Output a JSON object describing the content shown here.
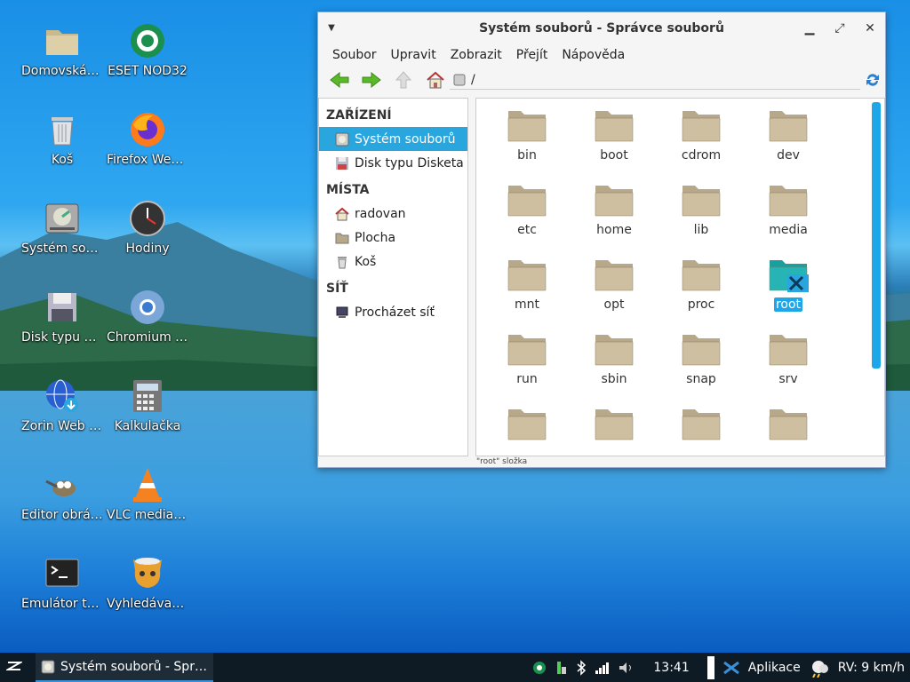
{
  "desktop": {
    "icons": [
      {
        "label": "Domovská složka",
        "icon": "home-folder-icon"
      },
      {
        "label": "ESET NOD32",
        "icon": "eset-icon"
      },
      {
        "label": "Koš",
        "icon": "trash-icon"
      },
      {
        "label": "Firefox Web Browser",
        "icon": "firefox-icon"
      },
      {
        "label": "Systém souborů",
        "icon": "filesystem-icon"
      },
      {
        "label": "Hodiny",
        "icon": "clock-icon"
      },
      {
        "label": "Disk typu Disketa",
        "icon": "floppy-icon"
      },
      {
        "label": "Chromium Web Browser",
        "icon": "chromium-icon"
      },
      {
        "label": "Zorin Web Browser",
        "icon": "web-install-icon"
      },
      {
        "label": "Kalkulačka",
        "icon": "calculator-icon"
      },
      {
        "label": "Editor obrázků",
        "icon": "gimp-icon"
      },
      {
        "label": "VLC media player",
        "icon": "vlc-icon"
      },
      {
        "label": "Emulátor terminálu",
        "icon": "terminal-icon"
      },
      {
        "label": "Vyhledávač souborů",
        "icon": "catfish-icon"
      }
    ]
  },
  "window": {
    "title": "Systém souborů - Správce souborů",
    "menu": [
      "Soubor",
      "Upravit",
      "Zobrazit",
      "Přejít",
      "Nápověda"
    ],
    "path": "/",
    "sidebar": {
      "devices_heading": "ZAŘÍZENÍ",
      "devices": [
        "Systém souborů",
        "Disk typu Disketa"
      ],
      "places_heading": "MÍSTA",
      "places": [
        "radovan",
        "Plocha",
        "Koš"
      ],
      "network_heading": "SÍŤ",
      "network": [
        "Procházet síť"
      ]
    },
    "files": [
      "bin",
      "boot",
      "cdrom",
      "dev",
      "etc",
      "home",
      "lib",
      "media",
      "mnt",
      "opt",
      "proc",
      "root",
      "run",
      "sbin",
      "snap",
      "srv",
      "",
      "",
      "",
      ""
    ],
    "selected_file": "root",
    "status": "\"root\" složka"
  },
  "taskbar": {
    "task_label": "Systém souborů - Správce souborů",
    "time": "13:41",
    "apps_label": "Aplikace",
    "weather": "RV: 9 km/h"
  },
  "colors": {
    "accent": "#2aa6df",
    "folder": "#b8a88a",
    "taskbar": "#0e1a24"
  }
}
